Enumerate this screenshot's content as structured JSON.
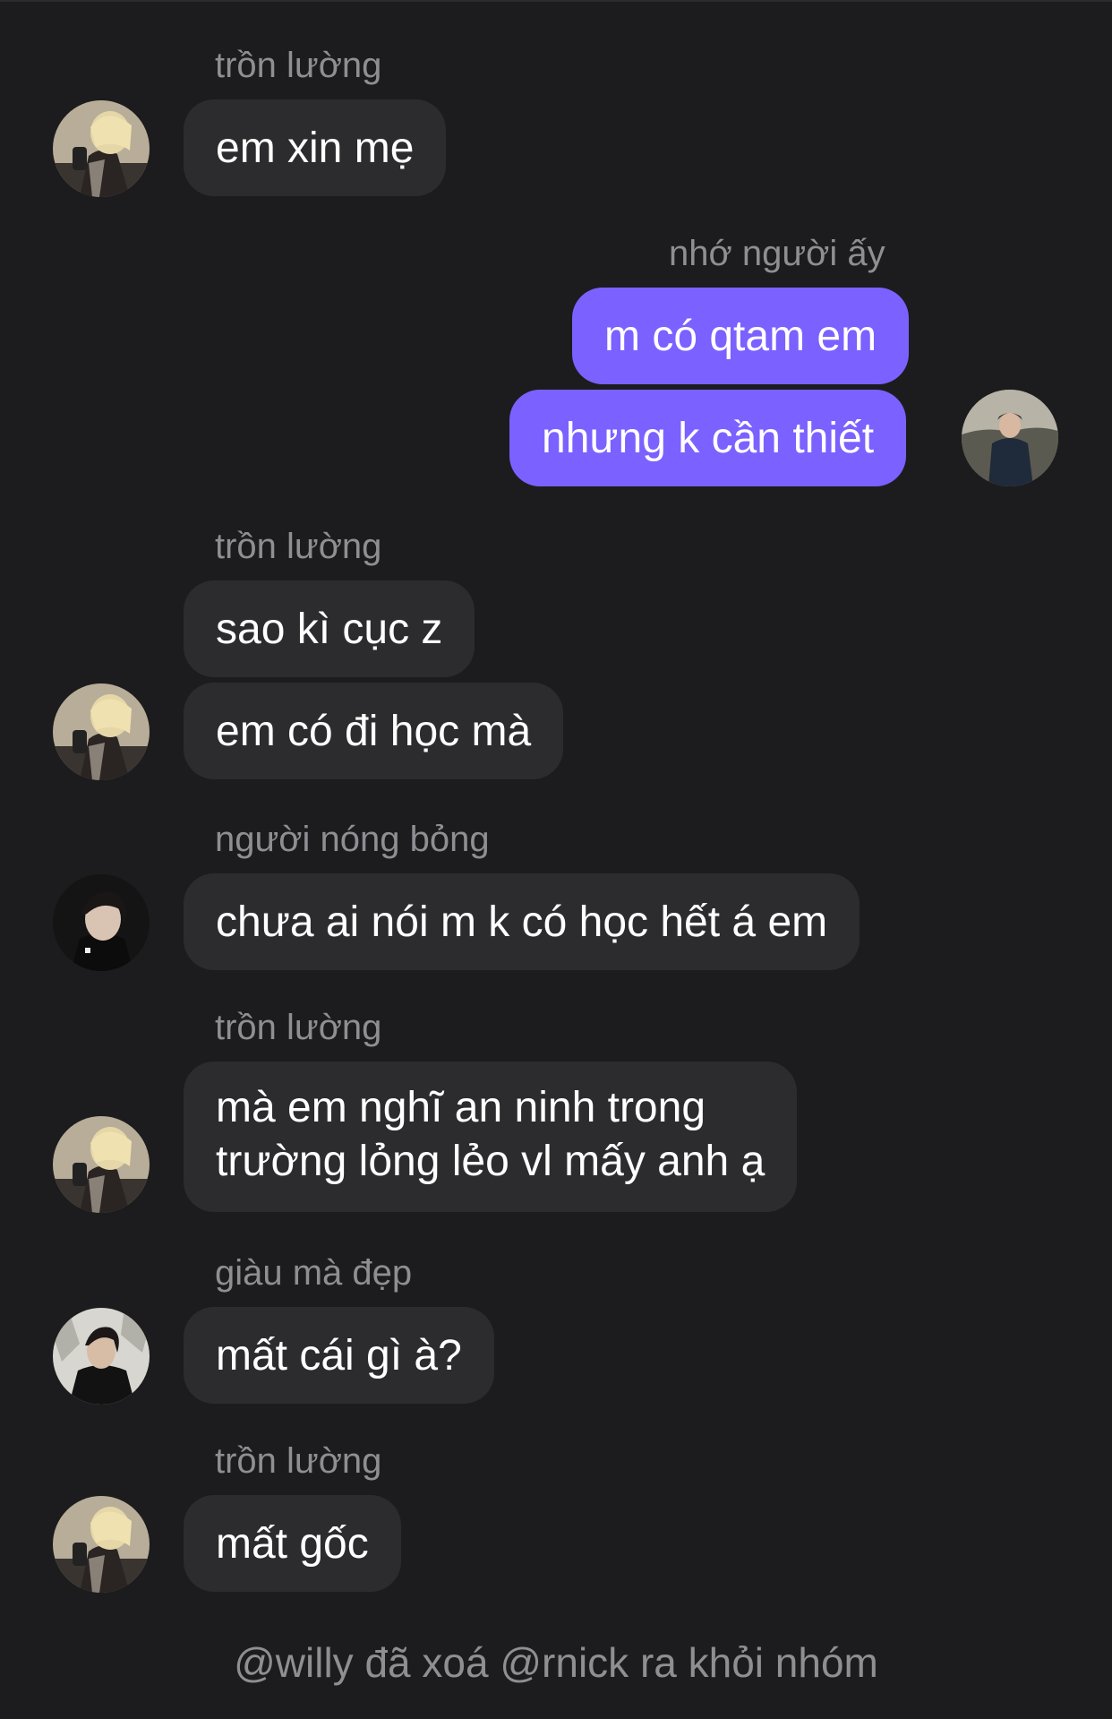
{
  "messages": [
    {
      "sender": "trồn lường",
      "text": "em xin mẹ"
    },
    {
      "sender": "nhớ người ấy",
      "texts": [
        "m có qtam em",
        "nhưng k cần thiết"
      ]
    },
    {
      "sender": "trồn lường",
      "texts": [
        "sao kì cục z",
        "em có đi học mà"
      ]
    },
    {
      "sender": "người nóng bỏng",
      "text": "chưa ai nói m k có học hết á em"
    },
    {
      "sender": "trồn lường",
      "lines": [
        "mà em nghĩ an ninh trong",
        "trường lỏng lẻo vl mấy anh ạ"
      ]
    },
    {
      "sender": "giàu mà đẹp",
      "text": "mất cái gì à?"
    },
    {
      "sender": "trồn lường",
      "text": "mất gốc"
    }
  ],
  "system_message": "@willy đã xoá @rnick ra khỏi nhóm",
  "colors": {
    "background": "#1c1c1e",
    "incoming_bubble": "#2c2c2e",
    "outgoing_bubble": "#7b61ff",
    "sender_name": "#8e8e93"
  }
}
